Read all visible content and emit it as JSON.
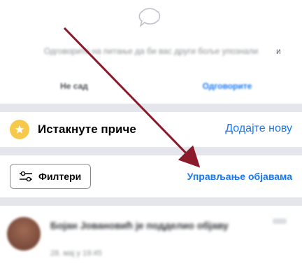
{
  "prompt": {
    "text": "Одговорите на питање да би вас други боље упознали",
    "tail": "и",
    "not_now_label": "Не сад",
    "answer_label": "Одговорите"
  },
  "featured": {
    "title": "Истакнуте приче",
    "add_label": "Додајте нову"
  },
  "filters": {
    "label": "Филтери",
    "manage_label": "Управљање објавама"
  },
  "post": {
    "title": "Бојан Јовановић је подделио објаву",
    "meta": "28. мај у 19:45"
  },
  "colors": {
    "accent": "#1877f2",
    "star_badge": "#f7c94b",
    "arrow": "#8b1a2b"
  },
  "icons": {
    "prompt": "speech-bubble-icon",
    "featured": "star-icon",
    "filters": "sliders-icon",
    "post_menu": "more-icon"
  }
}
